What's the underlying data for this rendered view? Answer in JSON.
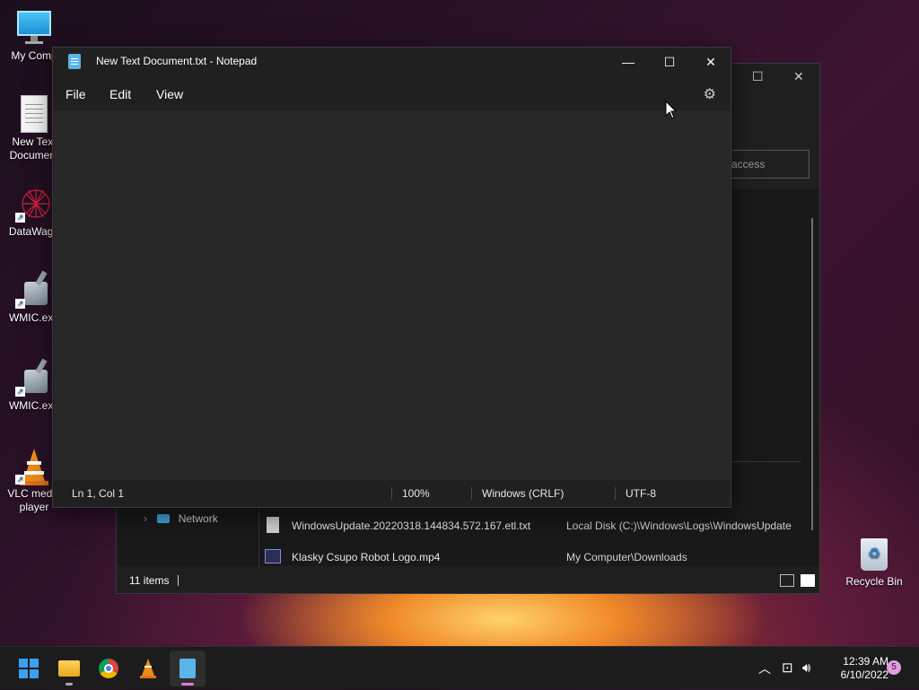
{
  "desktop": {
    "icons": [
      {
        "label": "My Comp",
        "icon": "computer-icon"
      },
      {
        "label": "New Text Document",
        "icon": "text-file-icon"
      },
      {
        "label": "DataWago",
        "icon": "datawago-icon"
      },
      {
        "label": "WMIC.exe",
        "icon": "wmic-icon"
      },
      {
        "label": "WMIC.exe",
        "icon": "wmic-icon"
      },
      {
        "label": "VLC media player",
        "icon": "vlc-icon"
      }
    ],
    "recycle_bin": {
      "label": "Recycle Bin"
    }
  },
  "explorer": {
    "search_placeholder": "access",
    "nav_network": "Network",
    "rows": [
      {
        "name": "WindowsUpdate.20220318.144834.572.167.etl.txt",
        "path": "Local Disk (C:)\\Windows\\Logs\\WindowsUpdate"
      },
      {
        "name": "Klasky Csupo Robot Logo.mp4",
        "path": "My Computer\\Downloads"
      }
    ],
    "status": {
      "items": "11 items"
    }
  },
  "notepad": {
    "title": "New Text Document.txt - Notepad",
    "menu": {
      "file": "File",
      "edit": "Edit",
      "view": "View"
    },
    "status": {
      "position": "Ln 1, Col 1",
      "zoom": "100%",
      "line_ending": "Windows (CRLF)",
      "encoding": "UTF-8"
    }
  },
  "taskbar": {
    "time": "12:39 AM",
    "date": "6/10/2022",
    "notification_count": "5"
  }
}
